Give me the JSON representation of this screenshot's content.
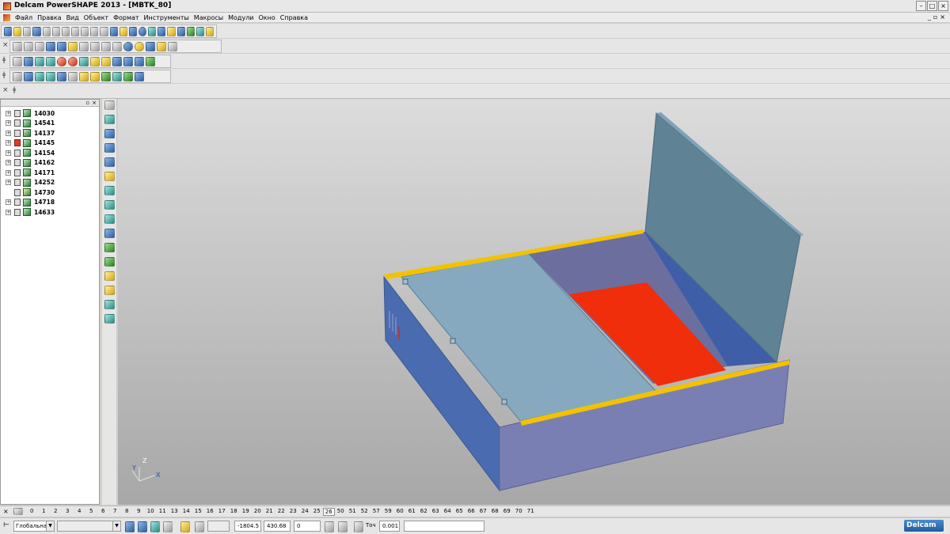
{
  "window": {
    "title": "Delcam PowerSHAPE 2013 - [MBTK_80]"
  },
  "menu": [
    "Файл",
    "Правка",
    "Вид",
    "Объект",
    "Формат",
    "Инструменты",
    "Макросы",
    "Модули",
    "Окно",
    "Справка"
  ],
  "tree": {
    "items": [
      {
        "label": "14030",
        "expandable": true,
        "locked_red": false
      },
      {
        "label": "14541",
        "expandable": true,
        "locked_red": false
      },
      {
        "label": "14137",
        "expandable": true,
        "locked_red": false
      },
      {
        "label": "14145",
        "expandable": true,
        "locked_red": true
      },
      {
        "label": "14154",
        "expandable": true,
        "locked_red": false
      },
      {
        "label": "14162",
        "expandable": true,
        "locked_red": false
      },
      {
        "label": "14171",
        "expandable": true,
        "locked_red": false
      },
      {
        "label": "14252",
        "expandable": true,
        "locked_red": false
      },
      {
        "label": "14730",
        "expandable": false,
        "locked_red": false
      },
      {
        "label": "14718",
        "expandable": true,
        "locked_red": false
      },
      {
        "label": "14633",
        "expandable": true,
        "locked_red": false
      }
    ]
  },
  "viewport": {
    "axis_labels": {
      "z": "Z",
      "y": "Y",
      "x": "X"
    },
    "colors": {
      "box_side": "#4b6bb0",
      "box_front": "#7a7fb3",
      "rim": "#f2c200",
      "lid": "#86a9bf",
      "inner_panel": "#f02e0c",
      "open_lid": "#5f8295"
    }
  },
  "levels": {
    "values": [
      "0",
      "1",
      "2",
      "3",
      "4",
      "5",
      "6",
      "7",
      "8",
      "9",
      "10",
      "11",
      "13",
      "14",
      "15",
      "16",
      "17",
      "18",
      "19",
      "20",
      "21",
      "22",
      "23",
      "24",
      "25",
      "26",
      "50",
      "51",
      "52",
      "57",
      "59",
      "60",
      "61",
      "62",
      "63",
      "64",
      "65",
      "66",
      "67",
      "68",
      "69",
      "70",
      "71"
    ],
    "active": "26"
  },
  "status": {
    "workplane": "Глобальна",
    "x": "-1804.5",
    "y": "430.68",
    "z": "0",
    "tolerance_label": "Точ",
    "tolerance": "0.001",
    "logo": "Delcam"
  }
}
